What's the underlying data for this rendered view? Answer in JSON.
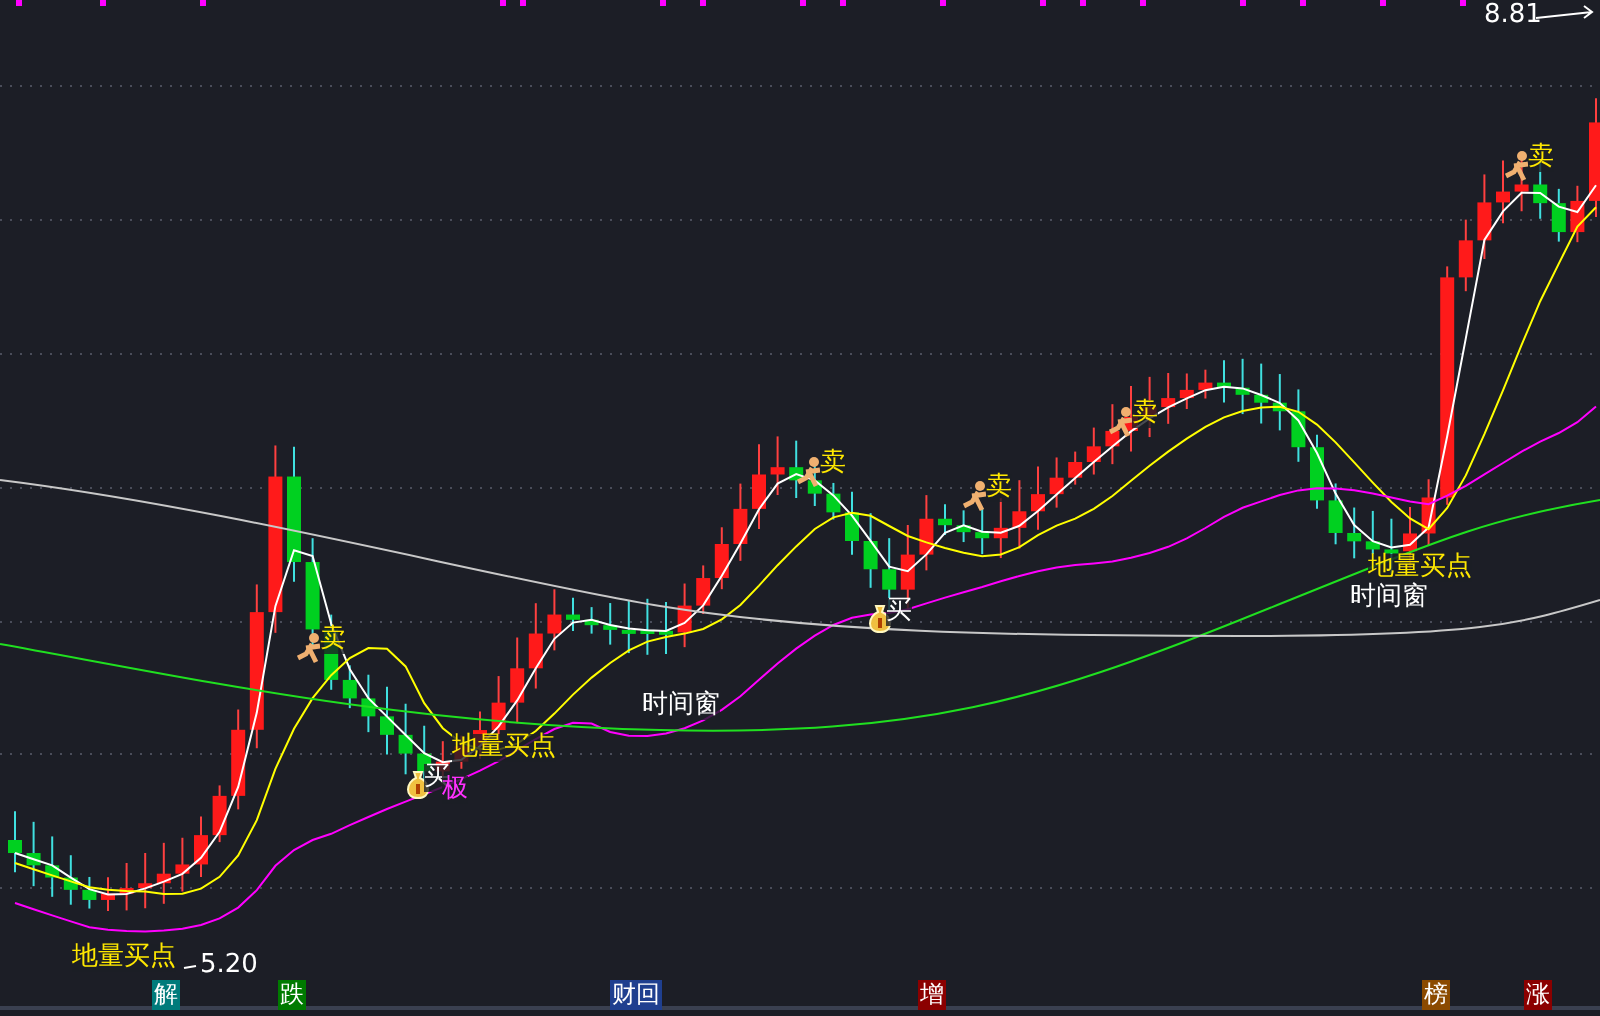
{
  "chart": {
    "price_high": "8.81",
    "price_low": "5.20",
    "signals": [
      {
        "kind": "sell",
        "text": "卖"
      },
      {
        "kind": "sell",
        "text": "卖"
      },
      {
        "kind": "sell",
        "text": "卖"
      },
      {
        "kind": "sell",
        "text": "卖"
      },
      {
        "kind": "sell",
        "text": "卖"
      },
      {
        "kind": "buy",
        "text": "买"
      },
      {
        "kind": "buy",
        "text": "买"
      },
      {
        "kind": "extreme",
        "text": "极"
      },
      {
        "kind": "low_volume",
        "text": "地量买点"
      },
      {
        "kind": "low_volume",
        "text": "地量买点"
      },
      {
        "kind": "low_volume",
        "text": "地量买点"
      },
      {
        "kind": "time_window",
        "text": "时间窗"
      },
      {
        "kind": "time_window",
        "text": "时间窗"
      }
    ],
    "tags": [
      {
        "text": "解",
        "color": "#007b7b"
      },
      {
        "text": "跌",
        "color": "#007a00"
      },
      {
        "text": "财回",
        "color": "#1f3f8f"
      },
      {
        "text": "增",
        "color": "#8b0000"
      },
      {
        "text": "榜",
        "color": "#8b4a00"
      },
      {
        "text": "涨",
        "color": "#8b0000"
      }
    ]
  }
}
